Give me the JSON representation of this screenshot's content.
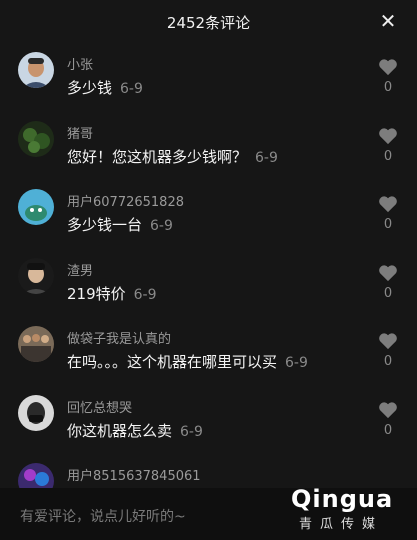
{
  "header": {
    "title": "2452条评论",
    "close_icon": "close-icon"
  },
  "comments": [
    {
      "name": "小张",
      "text": "多少钱",
      "date": "6-9",
      "likes": "0",
      "avatar": "avatar-photo-man"
    },
    {
      "name": "猪哥",
      "text": "您好！您这机器多少钱啊？",
      "date": "6-9",
      "likes": "0",
      "avatar": "avatar-green-plant"
    },
    {
      "name": "用户60772651828",
      "text": "多少钱一台",
      "date": "6-9",
      "likes": "0",
      "avatar": "avatar-default-blue"
    },
    {
      "name": "渣男",
      "text": "219特价",
      "date": "6-9",
      "likes": "0",
      "avatar": "avatar-photo-man-dark"
    },
    {
      "name": "做袋子我是认真的",
      "text": "在吗。。。这个机器在哪里可以买",
      "date": "6-9",
      "likes": "0",
      "avatar": "avatar-photo-group"
    },
    {
      "name": "回忆总想哭",
      "text": "你这机器怎么卖",
      "date": "6-9",
      "likes": "0",
      "avatar": "avatar-photo-mask"
    },
    {
      "name": "用户8515637845061",
      "text": "",
      "date": "",
      "likes": "",
      "avatar": "avatar-photo-colorful"
    }
  ],
  "input": {
    "placeholder": "有爱评论，说点儿好听的~"
  },
  "watermark": {
    "logo": "Qingua",
    "sub": "青瓜传媒"
  }
}
